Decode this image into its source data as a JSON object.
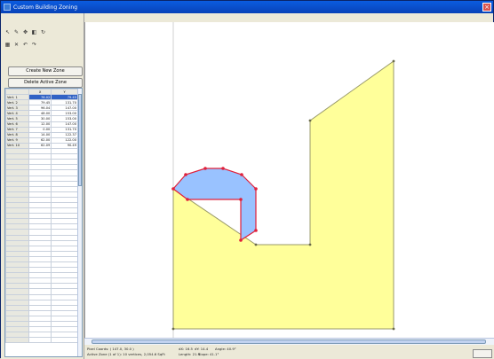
{
  "window": {
    "title": "Custom Building Zoning"
  },
  "toolbar": {
    "row1": [
      {
        "name": "select-icon",
        "glyph": "↖"
      },
      {
        "name": "pen-icon",
        "glyph": "✎"
      },
      {
        "name": "move-icon",
        "glyph": "✥"
      },
      {
        "name": "scale-icon",
        "glyph": "◧"
      },
      {
        "name": "rotate-icon",
        "glyph": "↻"
      }
    ],
    "row2": [
      {
        "name": "grid-icon",
        "glyph": "▦"
      },
      {
        "name": "delete-icon",
        "glyph": "✕"
      },
      {
        "name": "undo-icon",
        "glyph": "↶"
      },
      {
        "name": "redo-icon",
        "glyph": "↷"
      }
    ]
  },
  "buttons": {
    "create_zone": "Create New Zone",
    "delete_zone": "Delete Active Zone"
  },
  "grid": {
    "headers": [
      "",
      "X",
      "Y"
    ],
    "rows": [
      {
        "label": "Vert. 1",
        "x": "76.02",
        "y": "79.45",
        "selected": true
      },
      {
        "label": "Vert. 2",
        "x": "79.45",
        "y": "131.70"
      },
      {
        "label": "Vert. 3",
        "x": "96.04",
        "y": "147.00"
      },
      {
        "label": "Vert. 4",
        "x": "48.00",
        "y": "153.00"
      },
      {
        "label": "Vert. 5",
        "x": "30.00",
        "y": "153.00"
      },
      {
        "label": "Vert. 6",
        "x": "12.00",
        "y": "147.00"
      },
      {
        "label": "Vert. 7",
        "x": "0.00",
        "y": "131.70"
      },
      {
        "label": "Vert. 8",
        "x": "14.00",
        "y": "122.37"
      },
      {
        "label": "Vert. 9",
        "x": "62.00",
        "y": "122.00"
      },
      {
        "label": "Vert. 10",
        "x": "62.09",
        "y": "90.49"
      }
    ]
  },
  "status": {
    "pixel_coords": "Pixel Coords: ( 147.0, 30.0 )",
    "active_zone": "Active Zone (1 of 1):  10 vertices,  2,054.6 SqFt",
    "dx": "dX: 16.5",
    "dy": "dY: 14.4",
    "length": "Length: 21.9",
    "angle": "Angle: 40.9°",
    "slope": "Slope: 41.1°"
  },
  "colors": {
    "zone_outline": "#ffff9a",
    "active_zone": "#99c2ff",
    "active_edge": "#e0203a",
    "vertex": "#e0203a",
    "titlebar": "#0b5ce0"
  }
}
